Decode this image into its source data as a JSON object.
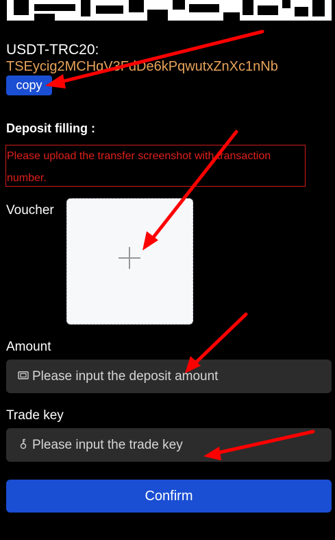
{
  "address": {
    "network_label": "USDT-TRC20:",
    "value": "TSEycig2MCHgV3FdDe6kPqwutxZnXc1nNb",
    "copy_label": "copy"
  },
  "deposit": {
    "title": "Deposit filling :",
    "notice": "Please upload the transfer screenshot with transaction number."
  },
  "voucher": {
    "label": "Voucher"
  },
  "amount": {
    "label": "Amount",
    "icon": "money-icon",
    "placeholder": "Please input the deposit amount"
  },
  "trade_key": {
    "label": "Trade key",
    "icon": "key-icon",
    "placeholder": "Please input the trade key"
  },
  "confirm_label": "Confirm",
  "colors": {
    "accent": "#1a4ed3",
    "address": "#e8a35a",
    "warning": "#e0201c",
    "annotation_arrow": "#ff0000"
  }
}
